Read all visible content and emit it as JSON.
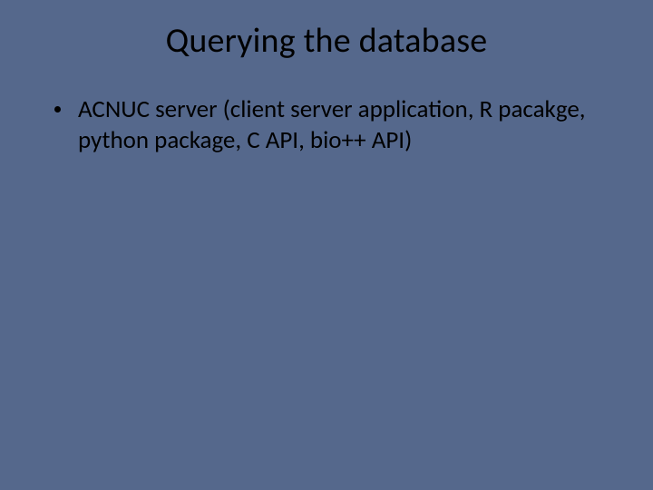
{
  "slide": {
    "title": "Querying the database",
    "bullets": [
      "ACNUC server (client server application, R pacakge, python package, C API, bio++ API)"
    ]
  }
}
